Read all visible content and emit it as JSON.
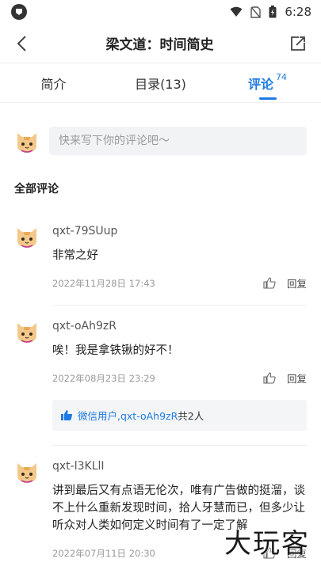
{
  "status_bar": {
    "time": "6:28"
  },
  "header": {
    "title": "梁文道：时间简史"
  },
  "tabs": [
    {
      "label": "简介"
    },
    {
      "label": "目录(13)"
    },
    {
      "label": "评论",
      "count": "74"
    }
  ],
  "composer": {
    "placeholder": "快来写下你的评论吧～"
  },
  "section_title": "全部评论",
  "comments": [
    {
      "user": "qxt-79SUup",
      "text": "非常之好",
      "date": "2022年11月28日 17:43",
      "reply_label": "回复"
    },
    {
      "user": "qxt-oAh9zR",
      "text": "唉！我是拿铁锹的好不！",
      "date": "2022年08月23日 23:29",
      "reply_label": "回复",
      "likes": {
        "names": "微信用户,qxt-oAh9zR",
        "suffix": "共2人"
      }
    },
    {
      "user": "qxt-l3KLlI",
      "text": "讲到最后又有点语无伦次，唯有广告做的挺溜，谈不上什么重新发现时间，拾人牙慧而已，但多少让听众对人类如何定义时间有了一定了解",
      "date": "2022年07月11日 20:30",
      "reply_label": "回复"
    }
  ],
  "watermark": "大玩客",
  "colors": {
    "accent": "#1d7be2",
    "avatar_fur": "#f3c98b",
    "avatar_stripes": "#e39a3b"
  }
}
